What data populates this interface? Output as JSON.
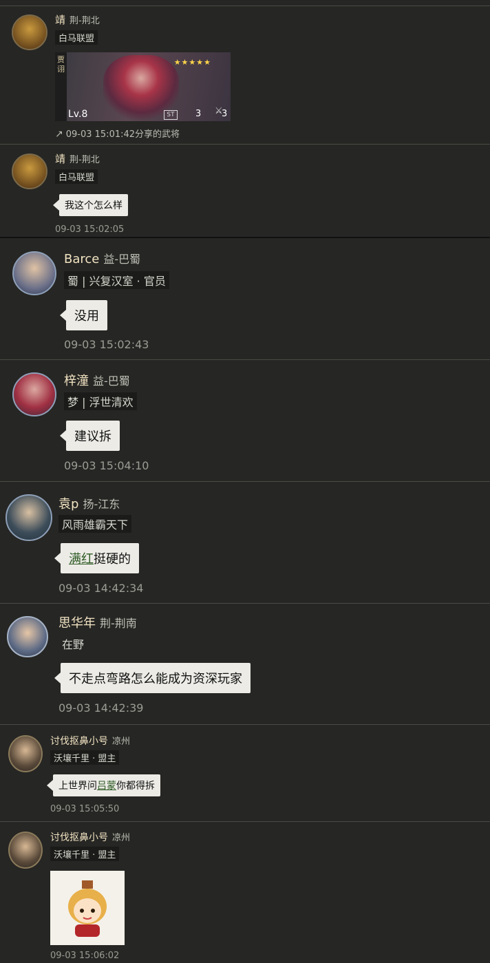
{
  "messages": [
    {
      "name": "靖",
      "region": "荆-荆北",
      "tag": "白马联盟",
      "share": {
        "side_label": "贾诩",
        "stars": "★★★★★",
        "level": "Lv.8",
        "stat1": "3",
        "stat2": "3",
        "caption": "09-03 15:01:42分享的武将"
      }
    },
    {
      "name": "靖",
      "region": "荆-荆北",
      "tag": "白马联盟",
      "text": "我这个怎么样",
      "time": "09-03 15:02:05"
    },
    {
      "name": "Barce",
      "region": "益-巴蜀",
      "tag": "蜀 | 兴复汉室 · 官员",
      "text": "没用",
      "time": "09-03 15:02:43"
    },
    {
      "name": "梓潼",
      "region": "益-巴蜀",
      "tag": "梦 | 浮世清欢",
      "text": "建议拆",
      "time": "09-03 15:04:10"
    },
    {
      "name": "袁p",
      "region": "扬-江东",
      "tag": "风雨雄霸天下",
      "text_hl": "满红",
      "text_rest": "挺硬的",
      "time": "09-03 14:42:34"
    },
    {
      "name": "思华年",
      "region": "荆-荆南",
      "tag": "在野",
      "text": "不走点弯路怎么能成为资深玩家",
      "time": "09-03 14:42:39"
    },
    {
      "name": "讨伐抠鼻小号",
      "region": "凉州",
      "tag": "沃壤千里 · 盟主",
      "text_pre": "上世界问",
      "text_hl": "吕蒙",
      "text_post": "你都得拆",
      "time": "09-03 15:05:50"
    },
    {
      "name": "讨伐抠鼻小号",
      "region": "凉州",
      "tag": "沃壤千里 · 盟主",
      "sticker": "sticker-emoji",
      "time": "09-03 15:06:02"
    }
  ],
  "colors": {
    "background": "#262624",
    "name": "#f1e3c2",
    "bubble": "#ecebe6",
    "highlight": "#2d5a23"
  }
}
